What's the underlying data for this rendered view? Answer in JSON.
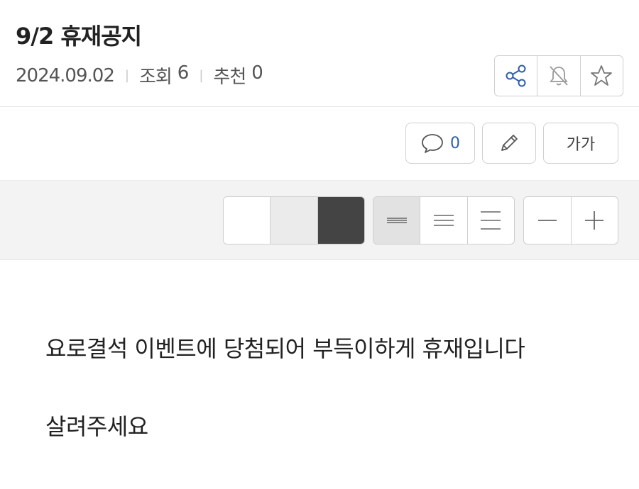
{
  "post": {
    "title": "9/2 휴재공지",
    "date": "2024.09.02",
    "views_label": "조회",
    "views": "6",
    "recommend_label": "추천",
    "recommend": "0"
  },
  "toolbar": {
    "comment_count": "0",
    "font_size_label": "가가"
  },
  "view_options": {
    "background_colors": [
      "#ffffff",
      "#ebebeb",
      "#444444"
    ],
    "selected_background": "#ffffff",
    "line_spacing_options": [
      "narrow",
      "medium",
      "wide"
    ],
    "selected_line_spacing": "narrow"
  },
  "content": {
    "paragraphs": [
      "요로결석 이벤트에 당첨되어 부득이하게 휴재입니다",
      "살려주세요"
    ]
  },
  "colors": {
    "accent": "#2f5fa8",
    "border": "#d0d0d0",
    "bar_background": "#f3f3f3"
  }
}
